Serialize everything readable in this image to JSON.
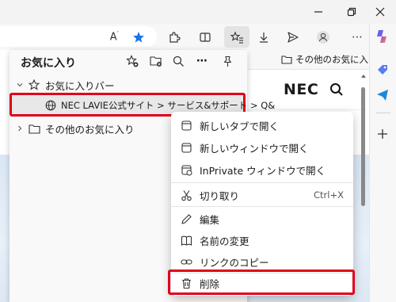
{
  "colors": {
    "accent": "#0f6cbd",
    "highlight": "#e0001b",
    "star": "#1a73e8"
  },
  "favorites_panel": {
    "title": "お気に入り",
    "tree": [
      {
        "label": "お気に入りバー",
        "icon": "star-outline-icon",
        "expanded": true
      },
      {
        "label": "NEC LAVIE公式サイト > サービス&サポート > Q&",
        "icon": "globe-icon"
      },
      {
        "label": "その他のお気に入り",
        "icon": "folder-icon",
        "expanded": false
      }
    ]
  },
  "bookmarks_bar": {
    "other_favorites": "その他のお気に入"
  },
  "site": {
    "logo": "NEC"
  },
  "context_menu": {
    "items": [
      {
        "label": "新しいタブで開く",
        "icon": "new-tab-icon"
      },
      {
        "label": "新しいウィンドウで開く",
        "icon": "new-window-icon"
      },
      {
        "label": "InPrivate ウィンドウで開く",
        "icon": "inprivate-icon"
      },
      {
        "label": "切り取り",
        "shortcut": "Ctrl+X",
        "icon": "scissors-icon"
      },
      {
        "label": "編集",
        "icon": "pencil-icon"
      },
      {
        "label": "名前の変更",
        "icon": "rename-icon"
      },
      {
        "label": "リンクのコピー",
        "icon": "link-icon"
      },
      {
        "label": "削除",
        "icon": "trash-icon"
      }
    ]
  }
}
